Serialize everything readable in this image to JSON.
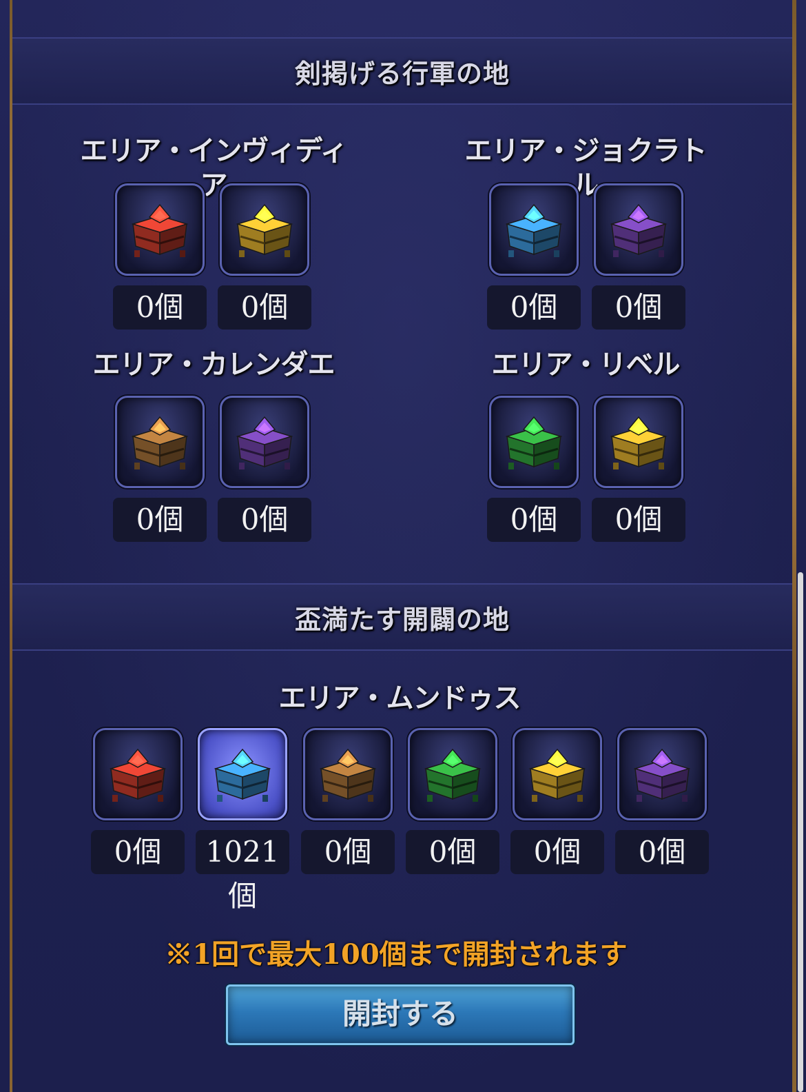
{
  "sections": [
    {
      "title": "剣掲げる行軍の地",
      "areas": [
        {
          "label": "エリア・インヴィディア",
          "chests": [
            {
              "color": "#c0392b",
              "count": "0個"
            },
            {
              "color": "#d4a72c",
              "count": "0個"
            }
          ]
        },
        {
          "label": "エリア・ジョクラトル",
          "chests": [
            {
              "color": "#3a8fd0",
              "count": "0個"
            },
            {
              "color": "#6b3fa0",
              "count": "0個"
            }
          ]
        },
        {
          "label": "エリア・カレンダエ",
          "chests": [
            {
              "color": "#9c6a35",
              "count": "0個"
            },
            {
              "color": "#6b3fa0",
              "count": "0個"
            }
          ]
        },
        {
          "label": "エリア・リベル",
          "chests": [
            {
              "color": "#2e9a3a",
              "count": "0個"
            },
            {
              "color": "#d4a72c",
              "count": "0個"
            }
          ]
        }
      ]
    },
    {
      "title": "盃満たす開闢の地",
      "areas": [
        {
          "label": "エリア・ムンドゥス",
          "chests": [
            {
              "color": "#c0392b",
              "count": "0個"
            },
            {
              "color": "#3a8fd0",
              "count": "1021個",
              "selected": true
            },
            {
              "color": "#9c6a35",
              "count": "0個"
            },
            {
              "color": "#2e9a3a",
              "count": "0個"
            },
            {
              "color": "#d4a72c",
              "count": "0個"
            },
            {
              "color": "#6b3fa0",
              "count": "0個"
            }
          ]
        }
      ]
    }
  ],
  "note": "※1回で最大100個まで開封されます",
  "open_button_label": "開封する"
}
